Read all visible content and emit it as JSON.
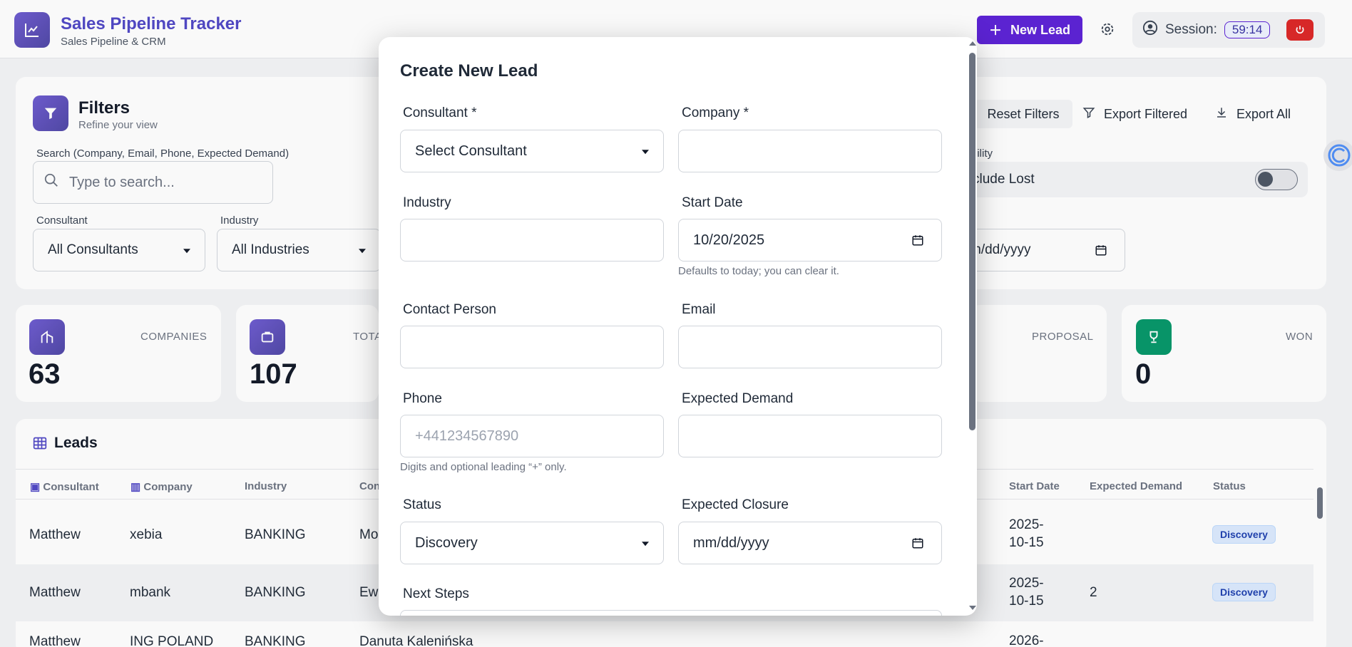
{
  "header": {
    "title": "Sales Pipeline Tracker",
    "subtitle": "Sales Pipeline & CRM",
    "new_lead_label": "New Lead",
    "session_label": "Session:",
    "session_time": "59:14"
  },
  "filters": {
    "title": "Filters",
    "subtitle": "Refine your view",
    "search_label": "Search (Company, Email, Phone, Expected Demand)",
    "search_placeholder": "Type to search...",
    "consultant_label": "Consultant",
    "consultant_value": "All Consultants",
    "industry_label": "Industry",
    "industry_value": "All Industries",
    "reset_label": "Reset Filters",
    "export_filtered_label": "Export Filtered",
    "export_all_label": "Export All",
    "visibility_label": "bility",
    "include_lost_label": "clude Lost",
    "date_to_value": "m/dd/yyyy"
  },
  "stats": [
    {
      "label": "COMPANIES",
      "value": "63"
    },
    {
      "label": "TOTA",
      "value": "107"
    },
    {
      "label": "PROPOSAL",
      "value": ""
    },
    {
      "label": "WON",
      "value": "0"
    }
  ],
  "leads": {
    "title": "Leads",
    "columns": [
      "Consultant",
      "Company",
      "Industry",
      "Con",
      "Start Date",
      "Expected Demand",
      "Status"
    ],
    "rows": [
      {
        "consultant": "Matthew",
        "company": "xebia",
        "industry": "BANKING",
        "contact": "Mo",
        "start1": "2025-",
        "start2": "10-15",
        "demand": "",
        "status": "Discovery"
      },
      {
        "consultant": "Matthew",
        "company": "mbank",
        "industry": "BANKING",
        "contact": "Ewa",
        "start1": "2025-",
        "start2": "10-15",
        "demand": "2",
        "status": "Discovery"
      },
      {
        "consultant": "Matthew",
        "company": "ING POLAND",
        "industry": "BANKING",
        "contact": "Danuta Kalenińska",
        "start1": "2026-",
        "start2": "",
        "demand": "",
        "status": ""
      }
    ]
  },
  "modal": {
    "title": "Create New Lead",
    "consultant_label": "Consultant *",
    "consultant_value": "Select Consultant",
    "company_label": "Company *",
    "company_value": "",
    "industry_label": "Industry",
    "industry_value": "",
    "start_date_label": "Start Date",
    "start_date_value": "10/20/2025",
    "start_date_hint": "Defaults to today; you can clear it.",
    "contact_label": "Contact Person",
    "contact_value": "",
    "email_label": "Email",
    "email_value": "",
    "phone_label": "Phone",
    "phone_placeholder": "+441234567890",
    "phone_hint": "Digits and optional leading “+” only.",
    "demand_label": "Expected Demand",
    "demand_value": "",
    "status_label": "Status",
    "status_value": "Discovery",
    "closure_label": "Expected Closure",
    "closure_value": "mm/dd/yyyy",
    "next_steps_label": "Next Steps"
  },
  "colors": {
    "brand": "#4f46c5",
    "primary_button": "#5b21d6",
    "danger": "#dc2626",
    "won": "#059669",
    "badge_bg": "#dbeafe"
  }
}
